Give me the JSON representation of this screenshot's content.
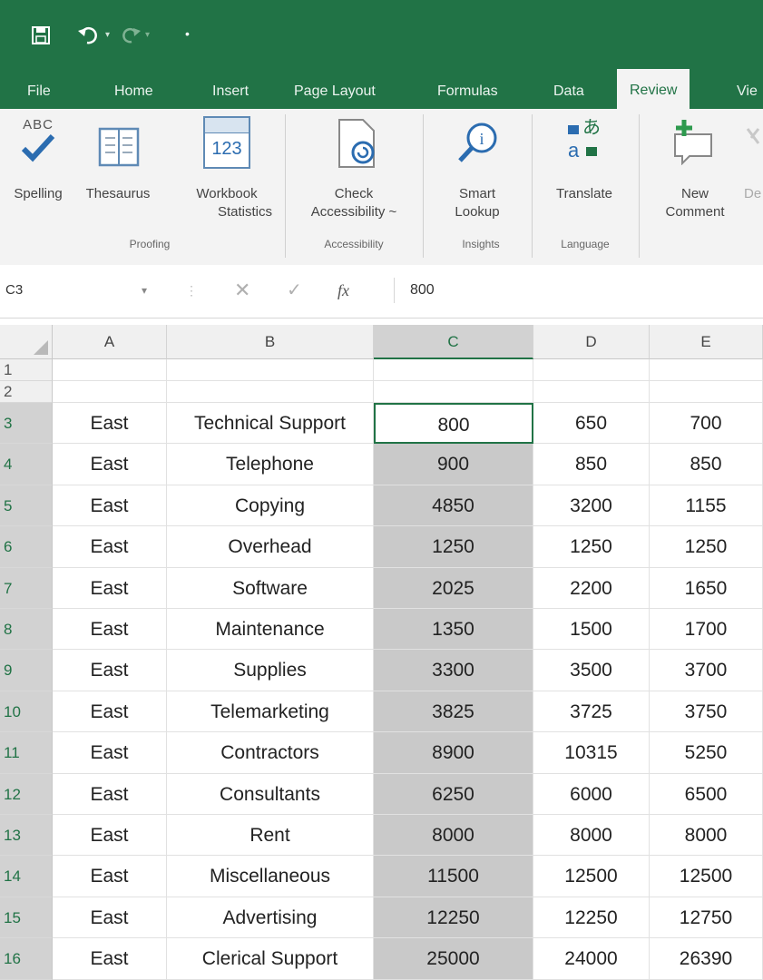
{
  "qat": {
    "save_icon": "save-icon",
    "undo_icon": "undo-icon",
    "redo_icon": "redo-icon",
    "customize_icon": "customize-qat-icon"
  },
  "tabs": [
    "File",
    "Home",
    "Insert",
    "Page Layout",
    "Formulas",
    "Data",
    "Review",
    "Vie"
  ],
  "active_tab": "Review",
  "ribbon": {
    "spelling": {
      "label": "Spelling",
      "icon_text": "ABC"
    },
    "thesaurus": {
      "label": "Thesaurus"
    },
    "workbook_statistics": {
      "label1": "Workbook",
      "label2": "Statistics",
      "icon_text": "123"
    },
    "proofing_group": "Proofing",
    "check_accessibility": {
      "label1": "Check",
      "label2": "Accessibility ~"
    },
    "accessibility_group": "Accessibility",
    "smart_lookup": {
      "label1": "Smart",
      "label2": "Lookup"
    },
    "insights_group": "Insights",
    "translate": {
      "label": "Translate"
    },
    "language_group": "Language",
    "new_comment": {
      "label1": "New",
      "label2": "Comment"
    },
    "delete_partial": "De"
  },
  "formula_bar": {
    "name_box": "C3",
    "fx": "fx",
    "formula": "800"
  },
  "columns": [
    "A",
    "B",
    "C",
    "D",
    "E"
  ],
  "rows": [
    {
      "num": "1",
      "cells": [
        "",
        "",
        "",
        "",
        ""
      ]
    },
    {
      "num": "2",
      "cells": [
        "",
        "",
        "",
        "",
        ""
      ]
    },
    {
      "num": "3",
      "cells": [
        "East",
        "Technical Support",
        "800",
        "650",
        "700"
      ]
    },
    {
      "num": "4",
      "cells": [
        "East",
        "Telephone",
        "900",
        "850",
        "850"
      ]
    },
    {
      "num": "5",
      "cells": [
        "East",
        "Copying",
        "4850",
        "3200",
        "1155"
      ]
    },
    {
      "num": "6",
      "cells": [
        "East",
        "Overhead",
        "1250",
        "1250",
        "1250"
      ]
    },
    {
      "num": "7",
      "cells": [
        "East",
        "Software",
        "2025",
        "2200",
        "1650"
      ]
    },
    {
      "num": "8",
      "cells": [
        "East",
        "Maintenance",
        "1350",
        "1500",
        "1700"
      ]
    },
    {
      "num": "9",
      "cells": [
        "East",
        "Supplies",
        "3300",
        "3500",
        "3700"
      ]
    },
    {
      "num": "10",
      "cells": [
        "East",
        "Telemarketing",
        "3825",
        "3725",
        "3750"
      ]
    },
    {
      "num": "11",
      "cells": [
        "East",
        "Contractors",
        "8900",
        "10315",
        "5250"
      ]
    },
    {
      "num": "12",
      "cells": [
        "East",
        "Consultants",
        "6250",
        "6000",
        "6500"
      ]
    },
    {
      "num": "13",
      "cells": [
        "East",
        "Rent",
        "8000",
        "8000",
        "8000"
      ]
    },
    {
      "num": "14",
      "cells": [
        "East",
        "Miscellaneous",
        "11500",
        "12500",
        "12500"
      ]
    },
    {
      "num": "15",
      "cells": [
        "East",
        "Advertising",
        "12250",
        "12250",
        "12750"
      ]
    },
    {
      "num": "16",
      "cells": [
        "East",
        "Clerical Support",
        "25000",
        "24000",
        "26390"
      ]
    }
  ],
  "selection": {
    "active_cell": "C3",
    "selected_column": "C",
    "selected_rows": [
      "3",
      "4",
      "5",
      "6",
      "7",
      "8",
      "9",
      "10",
      "11",
      "12",
      "13",
      "14",
      "15",
      "16"
    ]
  },
  "colors": {
    "accent": "#217346",
    "selection_fill": "#c9c9c9"
  }
}
